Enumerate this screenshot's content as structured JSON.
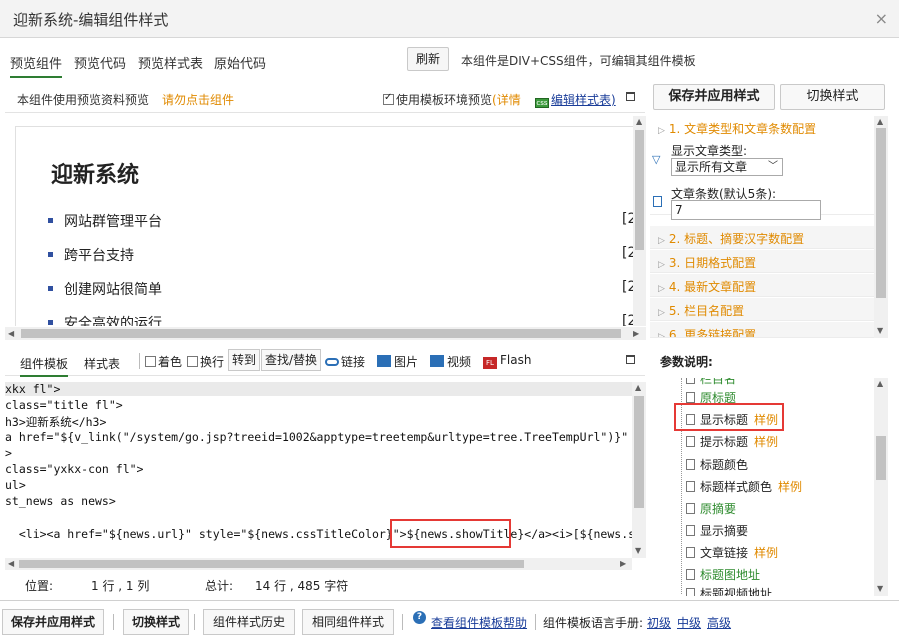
{
  "window": {
    "title": "迎新系统-编辑组件样式",
    "close_glyph": "×"
  },
  "top_tabs": [
    {
      "label": "预览组件",
      "active": true
    },
    {
      "label": "预览代码",
      "active": false
    },
    {
      "label": "预览样式表",
      "active": false
    },
    {
      "label": "原始代码",
      "active": false
    }
  ],
  "toolbar": {
    "refresh_label": "刷新",
    "note": "本组件是DIV+CSS组件，可编辑其组件模板"
  },
  "preview_bar": {
    "label": "本组件使用预览资料预览",
    "warning": "请勿点击组件",
    "use_template_env": "使用模板环境预览",
    "detail_link": "(详情",
    "edit_css_link": "编辑样式表)",
    "css_icon_text": "css"
  },
  "preview": {
    "title": "迎新系统",
    "items": [
      "网站群管理平台",
      "跨平台支持",
      "创建网站很简单",
      "安全高效的运行"
    ],
    "bracket": "[2"
  },
  "right_panel": {
    "save_apply_label": "保存并应用样式",
    "switch_style_label": "切换样式",
    "sections": [
      "1. 文章类型和文章条数配置",
      "2. 标题、摘要汉字数配置",
      "3. 日期格式配置",
      "4. 最新文章配置",
      "5. 栏目名配置",
      "6. 更多链接配置"
    ],
    "article_type_label": "显示文章类型:",
    "article_type_value": "显示所有文章",
    "article_count_label": "文章条数(默认5条):",
    "article_count_value": "7"
  },
  "editor_bar": {
    "tab_template": "组件模板",
    "tab_style": "样式表",
    "coloring": "着色",
    "wrap": "换行",
    "goto": "转到",
    "find_replace": "查找/替换",
    "link": "链接",
    "image": "图片",
    "video": "视频",
    "flash": "Flash",
    "flash_icon_text": "FL"
  },
  "code_lines": [
    "xkx fl\">",
    "class=\"title fl\">",
    "h3>迎新系统</h3>",
    "a href=\"${v_link(\"/system/go.jsp?treeid=1002&apptype=treetemp&urltype=tree.TreeTempUrl\")}\" cla",
    ">",
    "class=\"yxkx-con fl\">",
    "ul>",
    "st_news as news>",
    "",
    "  <li><a href=\"${news.url}\" style=\"${news.cssTitleColor}\">${news.showTitle}</a><i>[${news.sho"
  ],
  "status": {
    "position_label": "位置:",
    "position_value": "1 行 , 1 列",
    "total_label": "总计:",
    "total_value": "14 行 , 485 字符"
  },
  "params": {
    "title": "参数说明:",
    "items": [
      {
        "label": "栏目名",
        "color": "green",
        "example": ""
      },
      {
        "label": "原标题",
        "color": "green",
        "example": ""
      },
      {
        "label": "显示标题",
        "color": "dark",
        "example": "样例"
      },
      {
        "label": "提示标题",
        "color": "dark",
        "example": "样例"
      },
      {
        "label": "标题颜色",
        "color": "dark",
        "example": ""
      },
      {
        "label": "标题样式颜色",
        "color": "dark",
        "example": "样例"
      },
      {
        "label": "原摘要",
        "color": "green",
        "example": ""
      },
      {
        "label": "显示摘要",
        "color": "dark",
        "example": ""
      },
      {
        "label": "文章链接",
        "color": "dark",
        "example": "样例"
      },
      {
        "label": "标题图地址",
        "color": "green",
        "example": ""
      },
      {
        "label": "标题视频地址",
        "color": "dark",
        "example": ""
      }
    ]
  },
  "bottom": {
    "save_apply_label": "保存并应用样式",
    "switch_style_label": "切换样式",
    "history_label": "组件样式历史",
    "same_style_label": "相同组件样式",
    "help_link": "查看组件模板帮助",
    "help_icon_text": "?",
    "manual_label": "组件模板语言手册:",
    "level_basic": "初级",
    "level_mid": "中级",
    "level_high": "高级"
  },
  "colors": {
    "accent_orange": "#e08a00",
    "tab_underline": "#2e7d32",
    "highlight_red": "#e53935",
    "link_blue": "#1a3d99"
  }
}
